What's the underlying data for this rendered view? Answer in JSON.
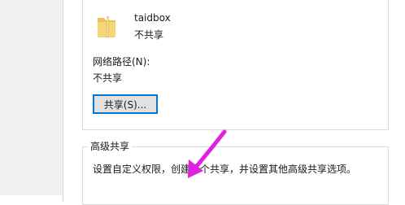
{
  "folder": {
    "name": "taidbox",
    "status": "不共享",
    "icon": "folder-icon"
  },
  "network_path": {
    "label": "网络路径(N):",
    "value": "不共享"
  },
  "share_button": {
    "label": "共享(S)..."
  },
  "advanced_sharing": {
    "title": "高级共享",
    "description": "设置自定义权限，创建多个共享，并设置其他高级共享选项。"
  },
  "colors": {
    "arrow": "#e020e0",
    "button_border": "#0078d7",
    "folder": "#e8c15a"
  }
}
